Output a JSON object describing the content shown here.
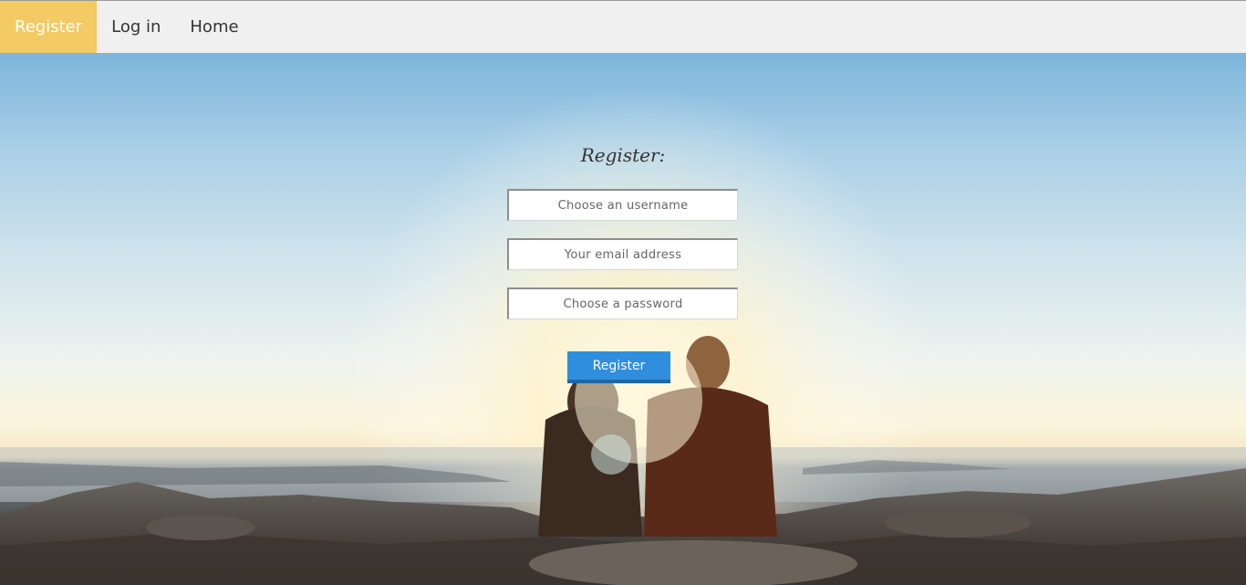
{
  "nav": {
    "items": [
      {
        "label": "Register",
        "active": true
      },
      {
        "label": "Log in",
        "active": false
      },
      {
        "label": "Home",
        "active": false
      }
    ]
  },
  "form": {
    "title": "Register:",
    "username_placeholder": "Choose an username",
    "email_placeholder": "Your email address",
    "password_placeholder": "Choose a password",
    "submit_label": "Register"
  },
  "colors": {
    "nav_active": "#f3ca63",
    "button": "#2f8fde"
  }
}
